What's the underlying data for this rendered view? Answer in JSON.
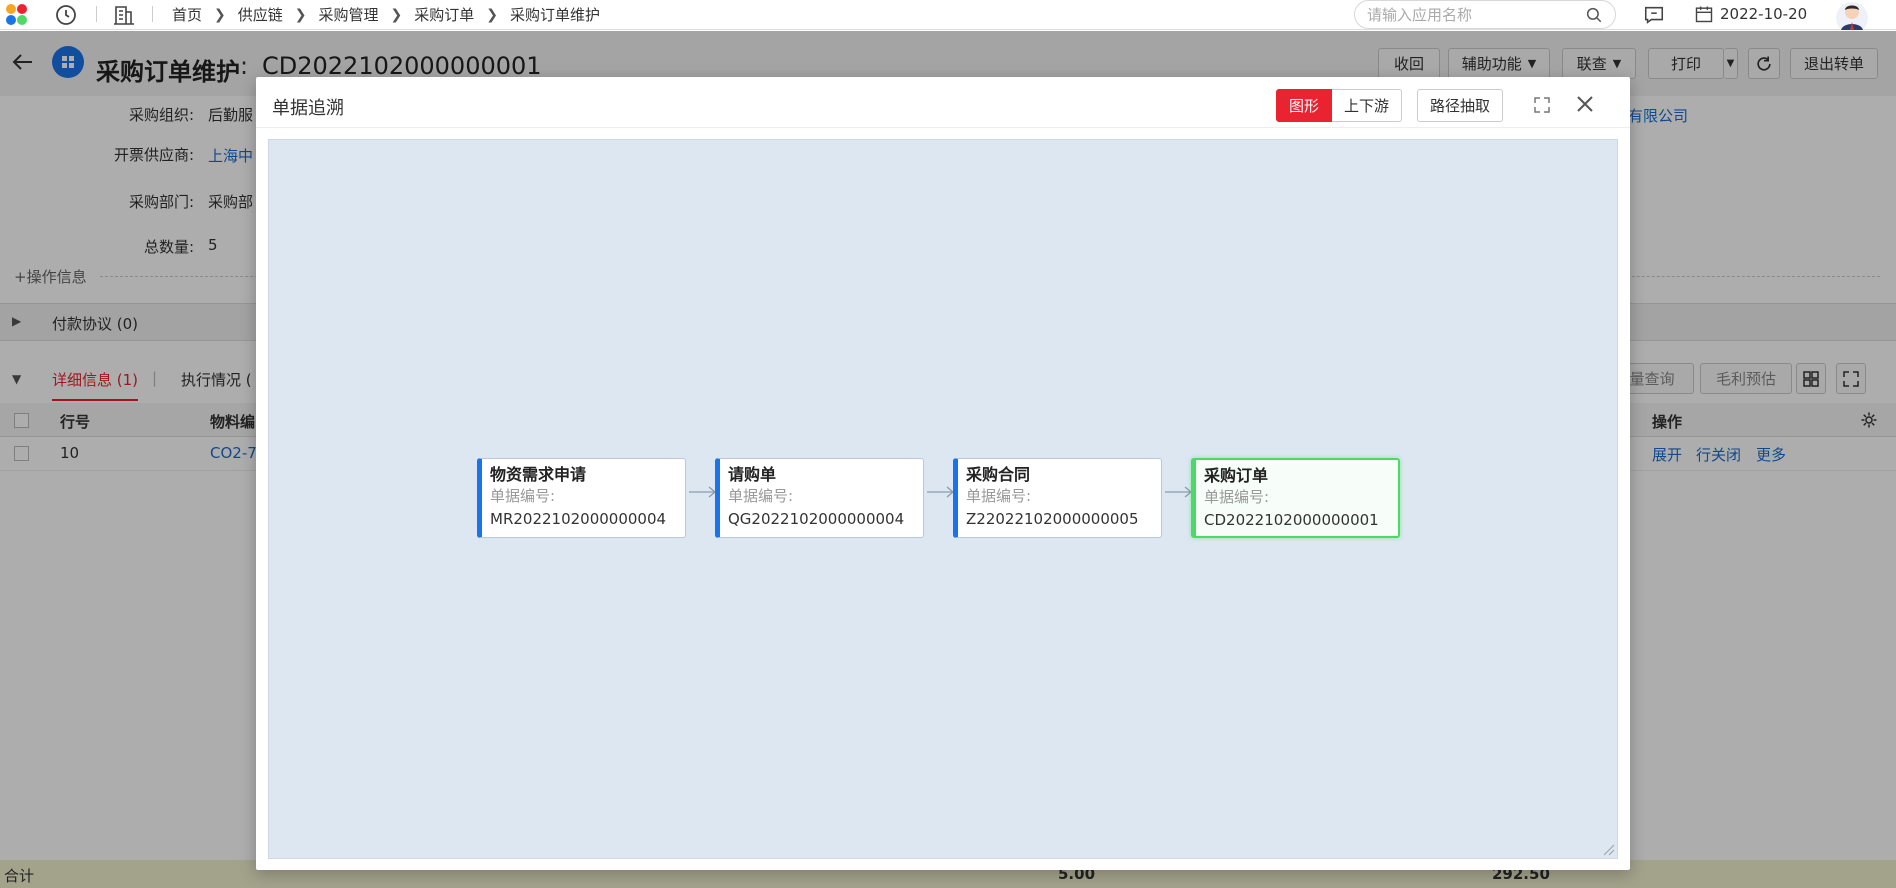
{
  "topbar": {
    "breadcrumbs": [
      "首页",
      "供应链",
      "采购管理",
      "采购订单",
      "采购订单维护"
    ],
    "search_placeholder": "请输入应用名称",
    "date": "2022-10-20"
  },
  "page": {
    "title": "采购订单维护",
    "separator": ":",
    "order_no": "CD2022102000000001",
    "actions": [
      "收回",
      "辅助功能",
      "联查",
      "打印",
      "退出转单"
    ],
    "form": {
      "purchase_org_label": "采购组织:",
      "purchase_org_value": "后勤服",
      "invoice_supplier_label": "开票供应商:",
      "invoice_supplier_value": "上海中",
      "purchase_dept_label": "采购部门:",
      "purchase_dept_value": "采购部",
      "total_qty_label": "总数量:",
      "total_qty_value": "5",
      "right_link": "有限公司",
      "op_info": "+操作信息"
    },
    "payment_section": "付款协议 (0)",
    "tabs": {
      "detail": "详细信息 (1)",
      "exec": "执行情况 (",
      "right_buttons": [
        "量查询",
        "毛利预估"
      ]
    },
    "grid": {
      "headers": [
        "行号",
        "物料编",
        "操作"
      ],
      "row": {
        "line_no": "10",
        "material": "CO2-7",
        "ops": [
          "展开",
          "行关闭",
          "更多"
        ]
      }
    },
    "footer": {
      "label": "合计",
      "qty": "5.00",
      "amount": "292.50"
    }
  },
  "modal": {
    "title": "单据追溯",
    "view_graph": "图形",
    "view_updown": "上下游",
    "path_extract": "路径抽取",
    "nodes": [
      {
        "title": "物资需求申请",
        "label": "单据编号:",
        "code": "MR2022102000000004"
      },
      {
        "title": "请购单",
        "label": "单据编号:",
        "code": "QG2022102000000004"
      },
      {
        "title": "采购合同",
        "label": "单据编号:",
        "code": "Z22022102000000005"
      },
      {
        "title": "采购订单",
        "label": "单据编号:",
        "code": "CD2022102000000001"
      }
    ]
  },
  "colors": {
    "accent_red": "#e9232f",
    "node_blue": "#1a73e8",
    "current_green": "#4cd964",
    "canvas_bg": "#dde7f2"
  }
}
